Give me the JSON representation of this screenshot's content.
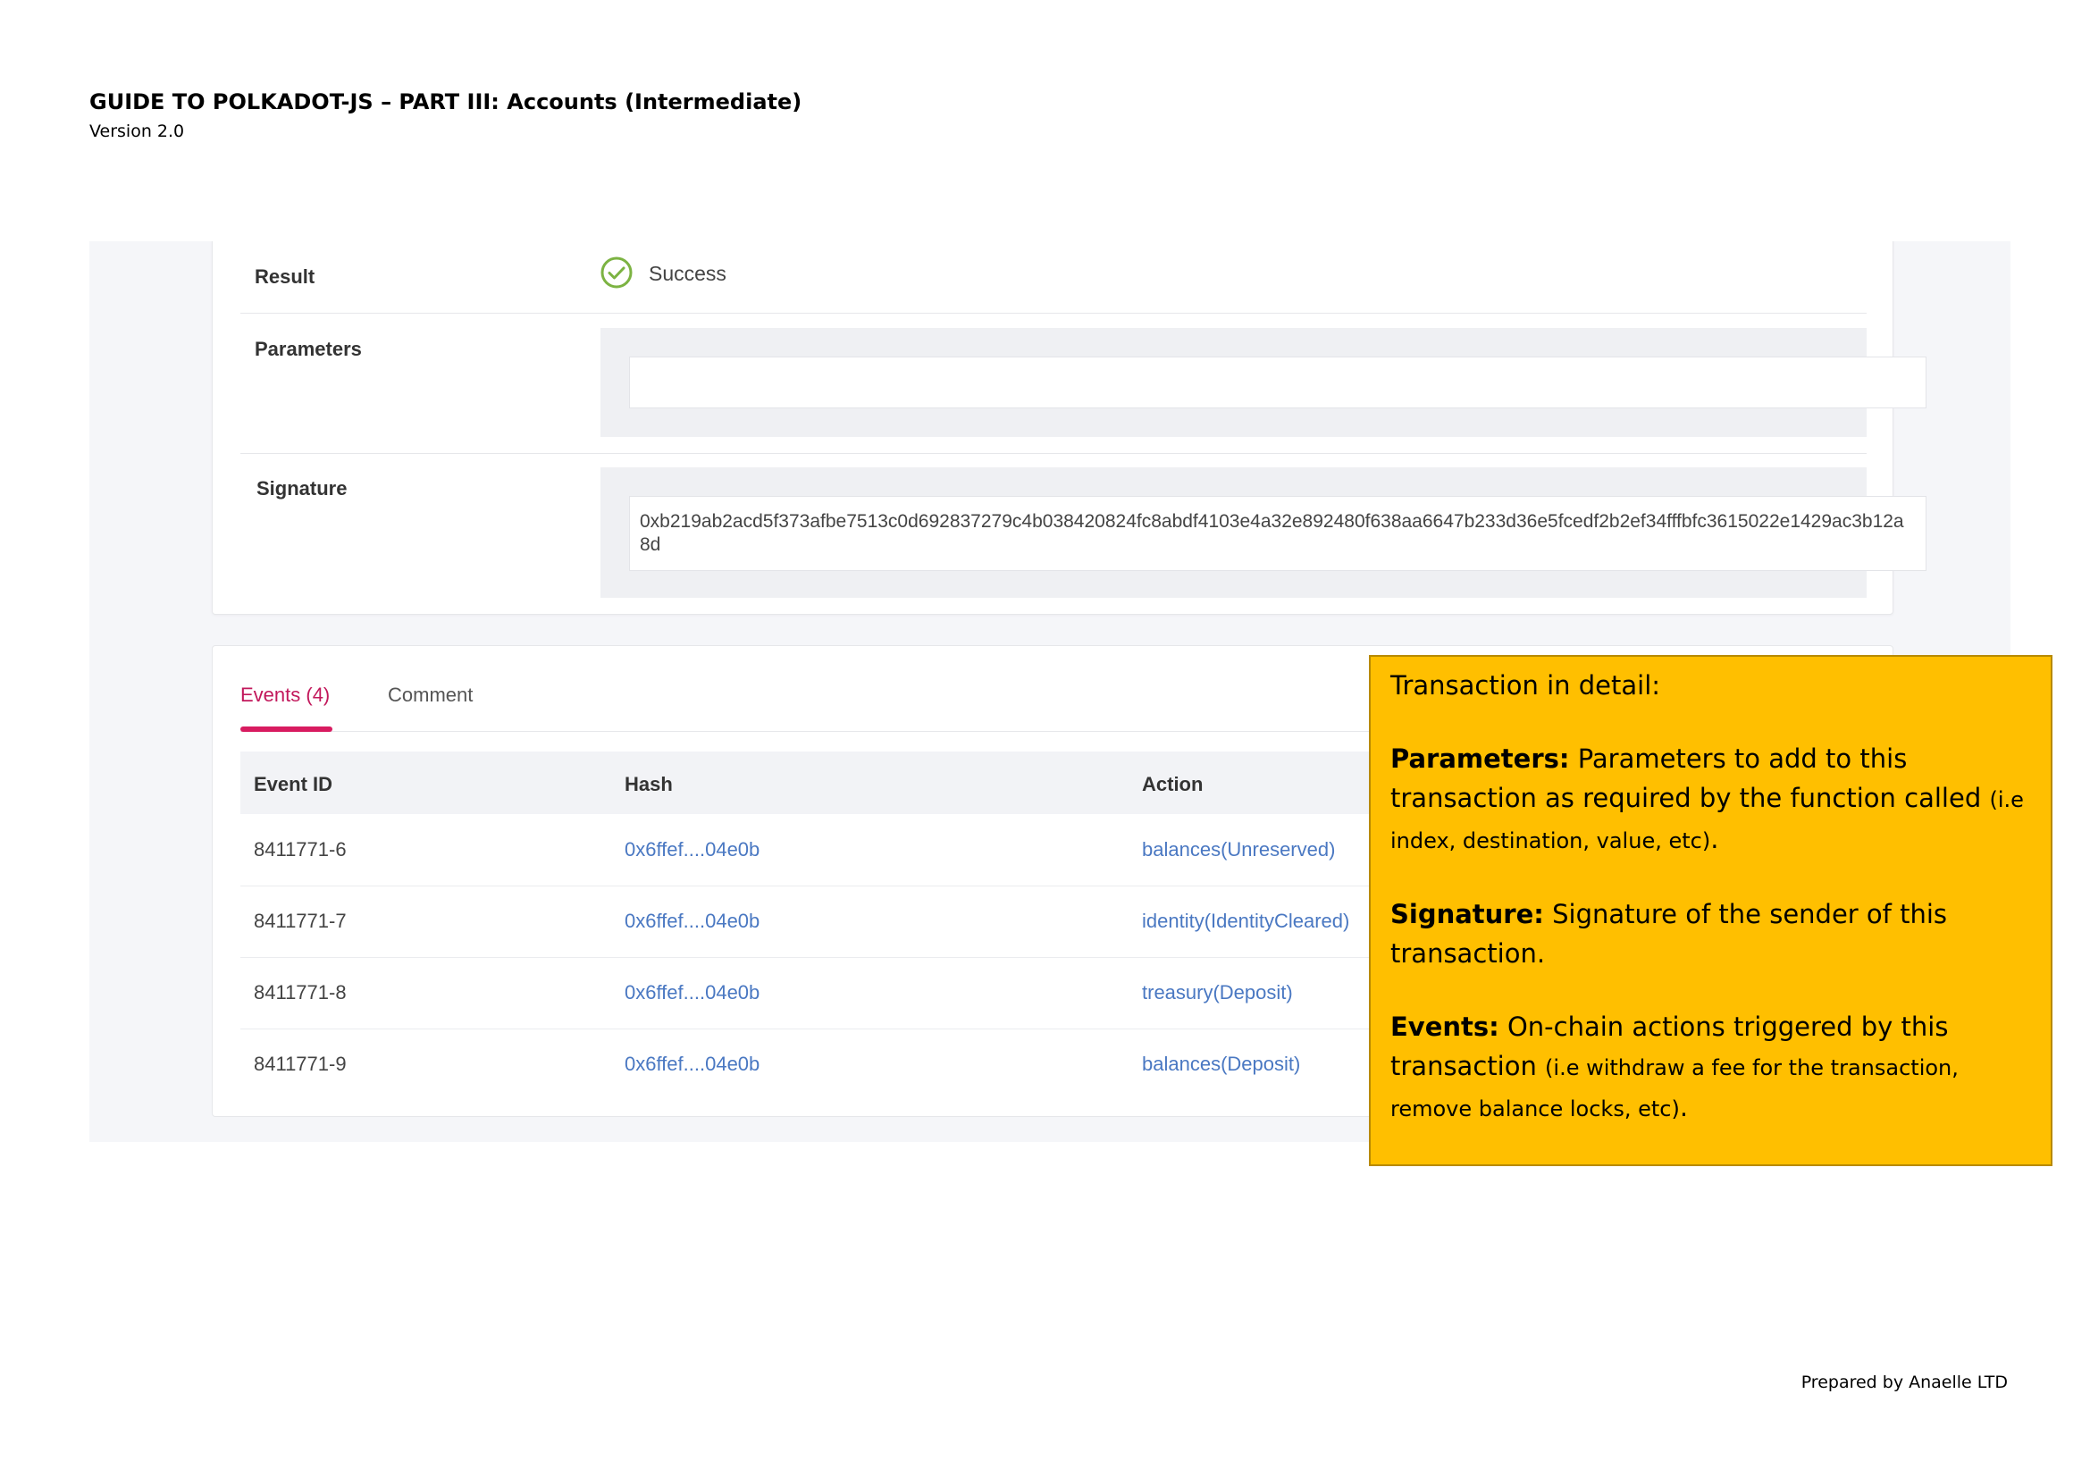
{
  "document": {
    "title": "GUIDE TO POLKADOT-JS – PART III: Accounts (Intermediate)",
    "version": "Version 2.0",
    "footer": "Prepared by Anaelle LTD"
  },
  "details": {
    "result_label": "Result",
    "result_value": "Success",
    "parameters_label": "Parameters",
    "parameters_value": "",
    "signature_label": "Signature",
    "signature_value": "0xb219ab2acd5f373afbe7513c0d692837279c4b038420824fc8abdf4103e4a32e892480f638aa6647b233d36e5fcedf2b2ef34fffbfc3615022e1429ac3b12a8d"
  },
  "events": {
    "tabs": [
      "Events (4)",
      "Comment"
    ],
    "columns": [
      "Event ID",
      "Hash",
      "Action"
    ],
    "rows": [
      {
        "id": "8411771-6",
        "hash": "0x6ffef....04e0b",
        "action": "balances(Unreserved)"
      },
      {
        "id": "8411771-7",
        "hash": "0x6ffef....04e0b",
        "action": "identity(IdentityCleared)"
      },
      {
        "id": "8411771-8",
        "hash": "0x6ffef....04e0b",
        "action": "treasury(Deposit)"
      },
      {
        "id": "8411771-9",
        "hash": "0x6ffef....04e0b",
        "action": "balances(Deposit)"
      }
    ]
  },
  "note": {
    "heading": "Transaction in detail:",
    "parameters_term": "Parameters:",
    "parameters_text": " Parameters to add to this transaction as required by the function called ",
    "parameters_small": "(i.e index, destination, value, etc)",
    "parameters_end": ".",
    "signature_term": "Signature:",
    "signature_text": " Signature of the sender of this transaction.",
    "events_term": "Events:",
    "events_text": " On-chain actions triggered by this transaction ",
    "events_small": "(i.e withdraw a fee for the transaction, remove balance locks, etc)",
    "events_end": "."
  },
  "colors": {
    "success": "#7cb342",
    "tab_active": "#d81b60",
    "link": "#4a78c2",
    "note_bg": "#ffbf00"
  }
}
